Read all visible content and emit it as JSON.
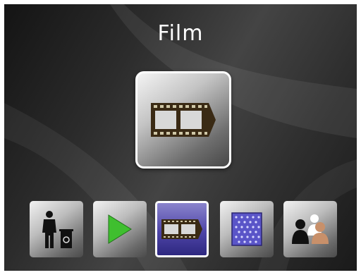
{
  "screen": {
    "title": "Film"
  },
  "main_tile": {
    "icon": "film-strip-icon"
  },
  "menu": {
    "items": [
      {
        "icon": "trash-delete-icon",
        "selected": false
      },
      {
        "icon": "play-icon",
        "selected": false
      },
      {
        "icon": "film-strip-icon",
        "selected": true
      },
      {
        "icon": "slide-frame-icon",
        "selected": false
      },
      {
        "icon": "people-group-icon",
        "selected": false
      }
    ]
  },
  "colors": {
    "title_text": "#ffffff",
    "selection_blue": "#4e45a8",
    "play_green": "#3fbf2f",
    "film_brown": "#3a2a14"
  }
}
